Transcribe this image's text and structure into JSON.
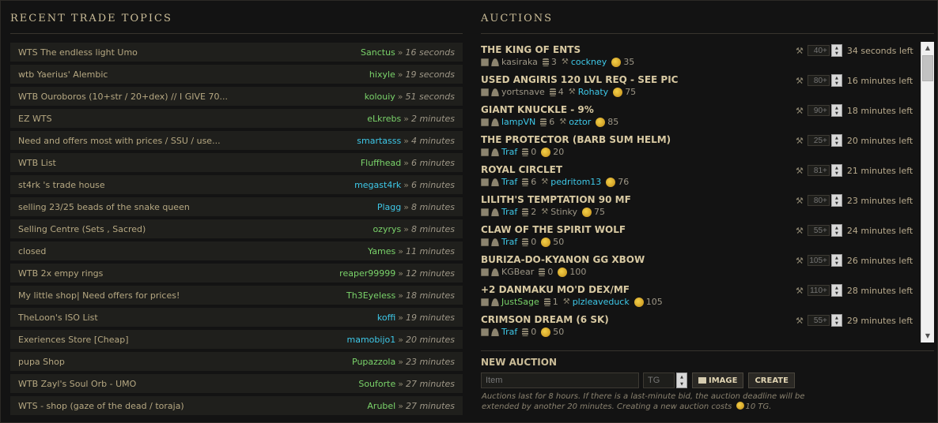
{
  "recent_topics": {
    "title": "Recent Trade Topics",
    "items": [
      {
        "title": "WTS The endless light Umo",
        "user": "Sanctus",
        "user_color": "green",
        "time": "16 seconds"
      },
      {
        "title": "wtb Yaerius' Alembic",
        "user": "hixyle",
        "user_color": "green",
        "time": "19 seconds"
      },
      {
        "title": "WTB Ouroboros (10+str / 20+dex) // I GIVE 70...",
        "user": "kolouiy",
        "user_color": "green",
        "time": "51 seconds"
      },
      {
        "title": "EZ WTS",
        "user": "eLkrebs",
        "user_color": "green",
        "time": "2 minutes"
      },
      {
        "title": "Need and offers most with prices / SSU / use...",
        "user": "smartasss",
        "user_color": "cyan",
        "time": "4 minutes"
      },
      {
        "title": "WTB List",
        "user": "Fluffhead",
        "user_color": "green",
        "time": "6 minutes"
      },
      {
        "title": "st4rk 's trade house",
        "user": "megast4rk",
        "user_color": "cyan",
        "time": "6 minutes"
      },
      {
        "title": "selling 23/25 beads of the snake queen",
        "user": "Plagg",
        "user_color": "cyan",
        "time": "8 minutes"
      },
      {
        "title": "Selling Centre (Sets , Sacred)",
        "user": "ozyrys",
        "user_color": "green",
        "time": "8 minutes"
      },
      {
        "title": "closed",
        "user": "Yames",
        "user_color": "green",
        "time": "11 minutes"
      },
      {
        "title": "WTB 2x empy rings",
        "user": "reaper99999",
        "user_color": "green",
        "time": "12 minutes"
      },
      {
        "title": "My little shop| Need offers for prices!",
        "user": "Th3Eyeless",
        "user_color": "green",
        "time": "18 minutes"
      },
      {
        "title": "TheLoon's ISO List",
        "user": "koffi",
        "user_color": "cyan",
        "time": "19 minutes"
      },
      {
        "title": "Exeriences Store [Cheap]",
        "user": "mamobijo1",
        "user_color": "cyan",
        "time": "20 minutes"
      },
      {
        "title": "pupa Shop",
        "user": "Pupazzola",
        "user_color": "green",
        "time": "23 minutes"
      },
      {
        "title": "WTB Zayl's Soul Orb - UMO",
        "user": "Souforte",
        "user_color": "green",
        "time": "27 minutes"
      },
      {
        "title": "WTS - shop (gaze of the dead / toraja)",
        "user": "Arubel",
        "user_color": "green",
        "time": "27 minutes"
      }
    ]
  },
  "auctions": {
    "title": "Auctions",
    "items": [
      {
        "name": "THE KING OF ENTS",
        "seller": "kasiraka",
        "seller_color": "grey",
        "bids": "3",
        "bidder": "cockney",
        "bidder_color": "cyan",
        "gold": "35",
        "min_bid": "40+",
        "time_left": "34 seconds left"
      },
      {
        "name": "USED ANGIRIS 120 LVL REQ - SEE PIC",
        "seller": "yortsnave",
        "seller_color": "grey",
        "bids": "4",
        "bidder": "Rohaty",
        "bidder_color": "cyan",
        "gold": "75",
        "min_bid": "80+",
        "time_left": "16 minutes left"
      },
      {
        "name": "GIANT KNUCKLE - 9%",
        "seller": "lampVN",
        "seller_color": "cyan",
        "bids": "6",
        "bidder": "oztor",
        "bidder_color": "cyan",
        "gold": "85",
        "min_bid": "90+",
        "time_left": "18 minutes left"
      },
      {
        "name": "THE PROTECTOR (BARB SUM HELM)",
        "seller": "Traf",
        "seller_color": "cyan",
        "bids": "0",
        "bidder": "",
        "bidder_color": "grey",
        "gold": "20",
        "min_bid": "25+",
        "time_left": "20 minutes left"
      },
      {
        "name": "ROYAL CIRCLET",
        "seller": "Traf",
        "seller_color": "cyan",
        "bids": "6",
        "bidder": "pedritom13",
        "bidder_color": "cyan",
        "gold": "76",
        "min_bid": "81+",
        "time_left": "21 minutes left"
      },
      {
        "name": "LILITH'S TEMPTATION 90 MF",
        "seller": "Traf",
        "seller_color": "cyan",
        "bids": "2",
        "bidder": "Stinky",
        "bidder_color": "grey",
        "gold": "75",
        "min_bid": "80+",
        "time_left": "23 minutes left"
      },
      {
        "name": "CLAW OF THE SPIRIT WOLF",
        "seller": "Traf",
        "seller_color": "cyan",
        "bids": "0",
        "bidder": "",
        "bidder_color": "grey",
        "gold": "50",
        "min_bid": "55+",
        "time_left": "24 minutes left"
      },
      {
        "name": "BURIZA-DO-KYANON GG XBOW",
        "seller": "KGBear",
        "seller_color": "grey",
        "bids": "0",
        "bidder": "",
        "bidder_color": "grey",
        "gold": "100",
        "min_bid": "105+",
        "time_left": "26 minutes left"
      },
      {
        "name": "+2 DANMAKU MO'D DEX/MF",
        "seller": "JustSage",
        "seller_color": "green",
        "bids": "1",
        "bidder": "plzleaveduck",
        "bidder_color": "cyan",
        "gold": "105",
        "min_bid": "110+",
        "time_left": "28 minutes left"
      },
      {
        "name": "CRIMSON DREAM (6 SK)",
        "seller": "Traf",
        "seller_color": "cyan",
        "bids": "0",
        "bidder": "",
        "bidder_color": "grey",
        "gold": "50",
        "min_bid": "55+",
        "time_left": "29 minutes left"
      }
    ]
  },
  "new_auction": {
    "title": "NEW AUCTION",
    "item_placeholder": "Item",
    "tg_placeholder": "TG",
    "image_label": "IMAGE",
    "create_label": "CREATE",
    "note_before": "Auctions last for 8 hours. If there is a last-minute bid, the auction deadline will be extended by another 20 minutes. Creating a new auction costs",
    "note_after": "10 TG."
  },
  "colors": {
    "green": "#7ad36a",
    "cyan": "#3ec8e8",
    "grey": "#9d9686"
  }
}
